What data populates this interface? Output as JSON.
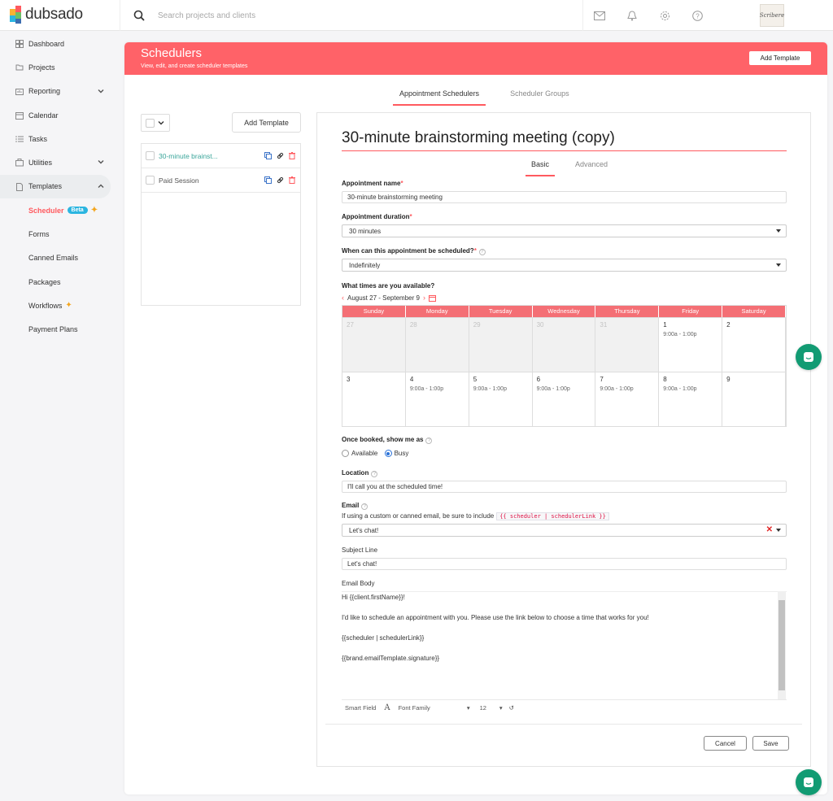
{
  "brand": {
    "name": "dubsado",
    "accent": "#ff5a5f",
    "banner_color": "#ff6268",
    "chat_color": "#129b73"
  },
  "search": {
    "placeholder": "Search projects and clients"
  },
  "topbar_icons": [
    "mail-icon",
    "bell-icon",
    "gear-icon",
    "help-icon"
  ],
  "avatar_text": "Scribere",
  "sidebar": {
    "items": [
      {
        "label": "Dashboard",
        "icon": "dashboard-icon"
      },
      {
        "label": "Projects",
        "icon": "projects-icon"
      },
      {
        "label": "Reporting",
        "icon": "reporting-icon"
      },
      {
        "label": "Calendar",
        "icon": "calendar-icon"
      },
      {
        "label": "Tasks",
        "icon": "tasks-icon"
      },
      {
        "label": "Utilities",
        "icon": "utilities-icon"
      },
      {
        "label": "Templates",
        "icon": "templates-icon"
      }
    ],
    "sub_items": [
      {
        "label": "Scheduler",
        "badge": "Beta"
      },
      {
        "label": "Forms"
      },
      {
        "label": "Canned Emails"
      },
      {
        "label": "Packages"
      },
      {
        "label": "Workflows"
      },
      {
        "label": "Payment Plans"
      }
    ]
  },
  "header": {
    "title": "Schedulers",
    "subtitle": "View, edit, and create scheduler templates",
    "add_button": "Add Template"
  },
  "tabs": [
    "Appointment Schedulers",
    "Scheduler Groups"
  ],
  "list": {
    "add_button": "Add Template",
    "items": [
      "30-minute brainst...",
      "Paid Session"
    ]
  },
  "form": {
    "title": "30-minute brainstorming meeting (copy)",
    "tabs": [
      "Basic",
      "Advanced"
    ],
    "appointment_name_label": "Appointment name",
    "appointment_name_value": "30-minute brainstorming meeting",
    "duration_label": "Appointment duration",
    "duration_value": "30 minutes",
    "when_label": "When can this appointment be scheduled?",
    "when_value": "Indefinitely",
    "times_label": "What times are you available?",
    "date_range": "August 27 -  September 9",
    "calendar": {
      "days": [
        "Sunday",
        "Monday",
        "Tuesday",
        "Wednesday",
        "Thursday",
        "Friday",
        "Saturday"
      ],
      "weeks": [
        [
          {
            "d": "27",
            "t": "",
            "past": true
          },
          {
            "d": "28",
            "t": "",
            "past": true
          },
          {
            "d": "29",
            "t": "",
            "past": true
          },
          {
            "d": "30",
            "t": "",
            "past": true
          },
          {
            "d": "31",
            "t": "",
            "past": true
          },
          {
            "d": "1",
            "t": "9:00a - 1:00p",
            "past": false
          },
          {
            "d": "2",
            "t": "",
            "past": false
          }
        ],
        [
          {
            "d": "3",
            "t": "",
            "past": false
          },
          {
            "d": "4",
            "t": "9:00a - 1:00p",
            "past": false
          },
          {
            "d": "5",
            "t": "9:00a - 1:00p",
            "past": false
          },
          {
            "d": "6",
            "t": "9:00a - 1:00p",
            "past": false
          },
          {
            "d": "7",
            "t": "9:00a - 1:00p",
            "past": false
          },
          {
            "d": "8",
            "t": "9:00a - 1:00p",
            "past": false
          },
          {
            "d": "9",
            "t": "",
            "past": false
          }
        ]
      ]
    },
    "show_as_label": "Once booked, show me as",
    "show_as_options": [
      "Available",
      "Busy"
    ],
    "show_as_selected": "Busy",
    "location_label": "Location",
    "location_value": "I'll call you at the scheduled time!",
    "email_label": "Email",
    "email_hint": "If using a custom or canned email, be sure to include",
    "email_hint_code": "{{ scheduler | schedulerLink }}",
    "email_value": "Let's chat!",
    "subject_label": "Subject Line",
    "subject_value": "Let's chat!",
    "body_label": "Email Body",
    "body_lines": [
      "Hi {{client.firstName}}!",
      "I'd like to schedule an appointment with you. Please use the link below to choose a time that works for you!",
      "{{scheduler | schedulerLink}}",
      "{{brand.emailTemplate.signature}}"
    ],
    "toolbar": {
      "smart_field": "Smart Field",
      "font_family": "Font Family",
      "font_size": "12"
    },
    "cancel": "Cancel",
    "save": "Save"
  }
}
